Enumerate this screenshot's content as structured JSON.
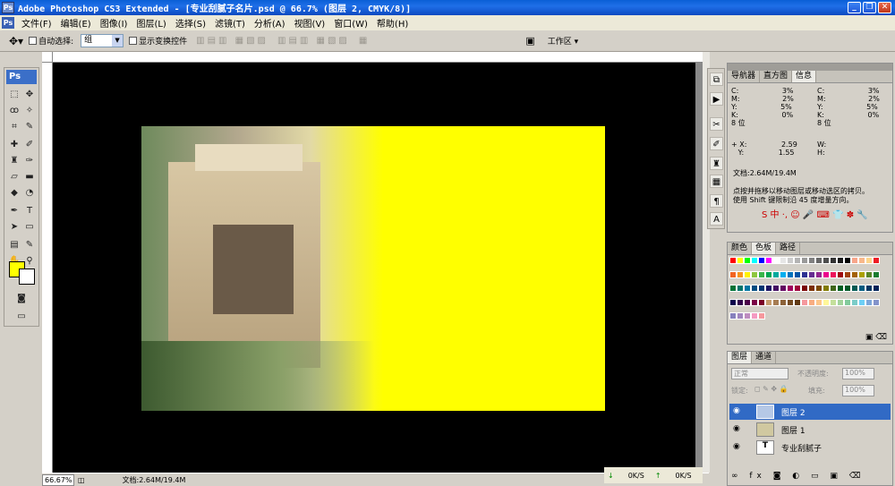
{
  "window": {
    "title": "Adobe Photoshop CS3 Extended - [专业刮腻子名片.psd @ 66.7% (图层 2, CMYK/8)]",
    "app_icon": "Ps",
    "min": "_",
    "restore": "❐",
    "close": "✕"
  },
  "menubar": {
    "icon": "Ps",
    "items": [
      "文件(F)",
      "编辑(E)",
      "图像(I)",
      "图层(L)",
      "选择(S)",
      "滤镜(T)",
      "分析(A)",
      "视图(V)",
      "窗口(W)",
      "帮助(H)"
    ]
  },
  "options": {
    "auto_select": "自动选择:",
    "auto_select_value": "组",
    "show_transform": "显示变换控件",
    "workspace": "工作区 ▾"
  },
  "toolbox": {
    "logo": "Ps"
  },
  "colors": {
    "foreground": "#ffff00",
    "background": "#ffffff"
  },
  "status": {
    "zoom": "66.67%",
    "doc": "文档:2.64M/19.4M",
    "transfer1": "0K/S",
    "transfer2": "0K/S"
  },
  "info_panel": {
    "tabs": [
      "导航器",
      "直方图",
      "信息"
    ],
    "left": {
      "C": "3%",
      "M": "2%",
      "Y": "5%",
      "K": "0%",
      "bits": "8 位"
    },
    "right": {
      "C": "3%",
      "M": "2%",
      "Y": "5%",
      "K": "0%",
      "bits": "8 位"
    },
    "x": "2.59",
    "y": "1.55",
    "w": "W:",
    "h": "H:",
    "docsize": "文档:2.64M/19.4M",
    "hint1": "点按并拖移以移动图层或移动选区的拷贝。",
    "hint2": "使用 Shift 键限制沿 45 度增量方向。",
    "ime": "中"
  },
  "color_panel": {
    "tabs": [
      "颜色",
      "色板",
      "路径"
    ]
  },
  "layers_panel": {
    "tabs": [
      "图层",
      "通道"
    ],
    "blend": "正常",
    "opacity_label": "不透明度:",
    "opacity": "100%",
    "lock_label": "锁定:",
    "fill_label": "填充:",
    "fill": "100%",
    "layers": [
      {
        "name": "图层 2"
      },
      {
        "name": "图层 1"
      },
      {
        "name": "专业刮腻子"
      }
    ]
  },
  "swatch_colors": [
    "#ff0000",
    "#ffff00",
    "#00ff00",
    "#00ffff",
    "#0000ff",
    "#ff00ff",
    "#ffffff",
    "#e6e6e6",
    "#cccccc",
    "#b3b3b3",
    "#999999",
    "#808080",
    "#666666",
    "#4d4d4d",
    "#333333",
    "#1a1a1a",
    "#000000",
    "#f7a58a",
    "#f8b88a",
    "#fcd58c",
    "#ee1c24",
    "#f26522",
    "#f7941d",
    "#fff200",
    "#8dc63f",
    "#39b54a",
    "#00a651",
    "#00a99d",
    "#00aeef",
    "#0072bc",
    "#0054a6",
    "#2e3192",
    "#662d91",
    "#92278f",
    "#ec008c",
    "#ed145b",
    "#9e0b0f",
    "#a0410d",
    "#a36209",
    "#aba000",
    "#598527",
    "#1a7b30",
    "#007236",
    "#00746b",
    "#0076a3",
    "#004b80",
    "#003471",
    "#1b1464",
    "#440e62",
    "#630460",
    "#9e005d",
    "#9e0039",
    "#790000",
    "#7b2e00",
    "#7d4900",
    "#827b00",
    "#406618",
    "#005e20",
    "#005826",
    "#005952",
    "#005b7f",
    "#003663",
    "#002157",
    "#0d004c",
    "#32004b",
    "#4b0049",
    "#7b0046",
    "#7a0026",
    "#c69c6d",
    "#a67c52",
    "#8c6239",
    "#754c24",
    "#603913",
    "#f5989d",
    "#f9ad81",
    "#fdc68a",
    "#fff799",
    "#c4df9b",
    "#a3d39c",
    "#82ca9c",
    "#7accc8",
    "#6dcff6",
    "#7da7d9",
    "#8393ca",
    "#8781bd",
    "#a186be",
    "#bd8cbf",
    "#f49ac1",
    "#f6989d"
  ]
}
